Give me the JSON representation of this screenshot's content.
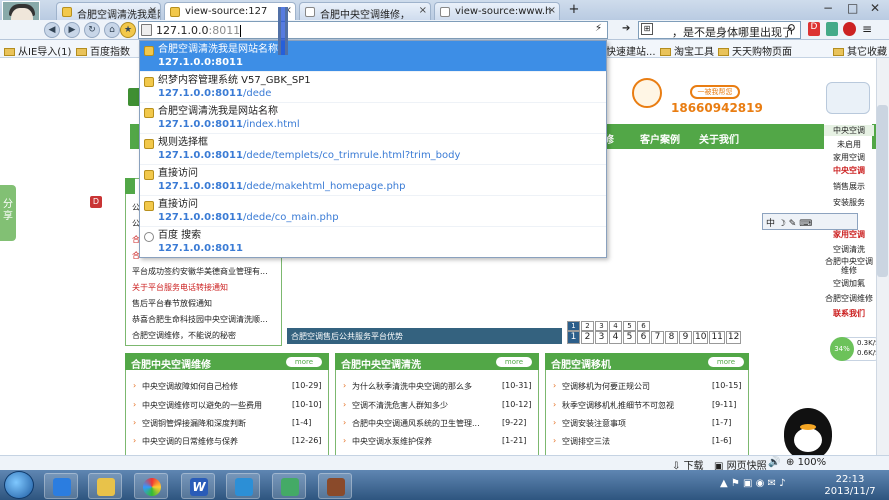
{
  "tabs": [
    {
      "label": "合肥空调清洗我是网站名"
    },
    {
      "label": "view-source:127"
    },
    {
      "label": "合肥中央空调维修，"
    },
    {
      "label": "view-source:www.h"
    }
  ],
  "address": {
    "typed": "127.1.0.0",
    "suggest": ":8011"
  },
  "search_text": "，是不是身体哪里出现了",
  "bookmarks": [
    "从IE导入(1)",
    "百度指数",
    "快速建站...",
    "淘宝工具",
    "天天购物页面",
    "其它收藏"
  ],
  "suggestions": [
    {
      "title": "合肥空调清洗我是网站名称",
      "url_host": "127.1.0.0:8011",
      "url_path": ""
    },
    {
      "title": "织梦内容管理系统 V57_GBK_SP1",
      "url_host": "127.1.0.0:8011",
      "url_path": "/dede"
    },
    {
      "title": "合肥空调清洗我是网站名称",
      "url_host": "127.1.0.0:8011",
      "url_path": "/index.html"
    },
    {
      "title": "规则选择框",
      "url_host": "127.1.0.0:8011",
      "url_path": "/dede/templets/co_trimrule.html?trim_body"
    },
    {
      "title": "直接访问",
      "url_host": "127.1.0.0:8011",
      "url_path": "/dede/makehtml_homepage.php"
    },
    {
      "title": "直接访问",
      "url_host": "127.1.0.0:8011",
      "url_path": "/dede/co_main.php"
    },
    {
      "title": "百度 搜索",
      "url_host": "127.1.0.0:8011",
      "url_path": ""
    }
  ],
  "site": {
    "help_label": "一被我帮您",
    "phone": "18660942819",
    "nav": [
      "修",
      "客户案例",
      "关于我们"
    ],
    "share_label": "分享",
    "badge": "D",
    "left_news": [
      "公",
      "公",
      "合",
      "合",
      "平台成功签约安徽华美德商业管理有...",
      "关于平台服务电话转接通知",
      "售后平台春节放假通知",
      "恭喜合肥生命科技园中央空调清洗顺...",
      "合肥空调维修，不能说的秘密"
    ],
    "blue_bar": "合肥空调售后公共服务平台优势",
    "pager_top": [
      "1",
      "2",
      "3",
      "4",
      "5",
      "6"
    ],
    "pager_main": [
      "1",
      "2",
      "3",
      "4",
      "5",
      "6",
      "7",
      "8",
      "9",
      "10",
      "11",
      "12"
    ],
    "more": "more",
    "columns": [
      {
        "title": "合肥中央空调维修",
        "items": [
          {
            "t": "中央空调故障如何自己检修",
            "d": "[10-29]"
          },
          {
            "t": "中央空调维修可以避免的一些费用",
            "d": "[10-10]"
          },
          {
            "t": "空调铜管焊接漏降和深度判断",
            "d": "[1-4]"
          },
          {
            "t": "中央空调的日常维修与保养",
            "d": "[12-26]"
          }
        ]
      },
      {
        "title": "合肥中央空调清洗",
        "items": [
          {
            "t": "为什么秋季清洗中央空调的那么多",
            "d": "[10-31]"
          },
          {
            "t": "空调不清洗危害人群知多少",
            "d": "[10-12]"
          },
          {
            "t": "合肥中央空调通风系统的卫生管理...",
            "d": "[9-22]"
          },
          {
            "t": "中央空调水泵维护保养",
            "d": "[1-21]"
          }
        ]
      },
      {
        "title": "合肥空调移机",
        "items": [
          {
            "t": "空调移机为何要正规公司",
            "d": "[10-15]"
          },
          {
            "t": "秋季空调移机札推细节不可忽视",
            "d": "[9-11]"
          },
          {
            "t": "空调安装注意事项",
            "d": "[1-7]"
          },
          {
            "t": "空调排空三法",
            "d": "[1-6]"
          }
        ]
      }
    ],
    "right_panel": [
      "中央空调",
      "未启用",
      "家用空调",
      "中央空调",
      "销售展示",
      "安装服务",
      "家用空调",
      "空调清洗",
      "合肥中央空调",
      "维修",
      "空调加氟",
      "合肥空调维修",
      "联系我们"
    ]
  },
  "ime": "中 ☽ ✎ ⌨",
  "speed": {
    "pct": "34%",
    "up": "0.3K/S",
    "down": "0.6K/S"
  },
  "status": {
    "download": "下载",
    "snapshot": "网页快照",
    "zoom": "100%"
  },
  "clock": {
    "time": "22:13",
    "date": "2013/11/7"
  },
  "colors": {
    "green": "#52a747",
    "orange": "#e97d12",
    "select": "#3d8ee6"
  }
}
